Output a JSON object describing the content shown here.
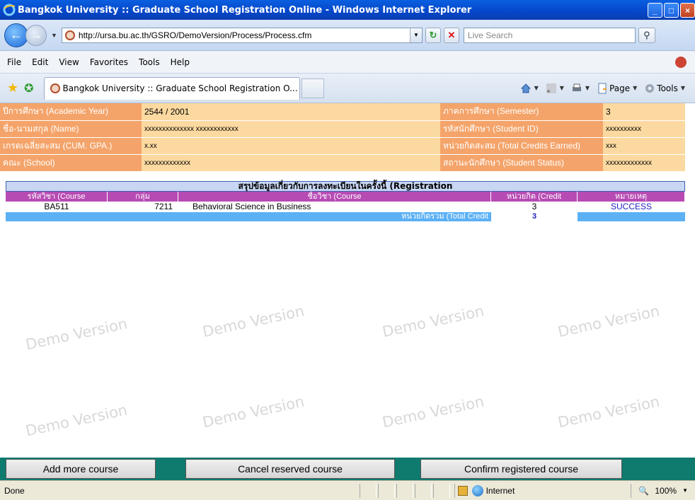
{
  "window": {
    "title": "Bangkok University :: Graduate School Registration Online - Windows Internet Explorer",
    "minimize": "_",
    "maximize": "□",
    "close": "×"
  },
  "address": {
    "url": "http://ursa.bu.ac.th/GSRO/DemoVersion/Process/Process.cfm",
    "search_placeholder": "Live Search"
  },
  "menu": [
    "File",
    "Edit",
    "View",
    "Favorites",
    "Tools",
    "Help"
  ],
  "tab": {
    "label": "Bangkok University :: Graduate School Registration O..."
  },
  "commands": {
    "page": "Page",
    "tools": "Tools"
  },
  "student_info": {
    "academic_year": {
      "label": "ปีการศึกษา (Academic Year)",
      "value": "2544 / 2001"
    },
    "semester": {
      "label": "ภาคการศึกษา (Semester)",
      "value": "3"
    },
    "name": {
      "label": "ชื่อ-นามสกุล (Name)",
      "value": "xxxxxxxxxxxxxx xxxxxxxxxxxx"
    },
    "student_id": {
      "label": "รหัสนักศึกษา (Student ID)",
      "value": "xxxxxxxxxx"
    },
    "gpa": {
      "label": "เกรดเฉลี่ยสะสม (CUM. GPA.)",
      "value": "x.xx"
    },
    "credits_earned": {
      "label": "หน่วยกิตสะสม (Total Credits Earned)",
      "value": "xxx"
    },
    "school": {
      "label": "คณะ (School)",
      "value": "xxxxxxxxxxxxx"
    },
    "status": {
      "label": "สถานะนักศึกษา (Student Status)",
      "value": "xxxxxxxxxxxxx"
    }
  },
  "registration": {
    "heading": "สรุปข้อมูลเกี่ยวกับการลงทะเบียนในครั้งนี้ (Registration",
    "columns": {
      "course": "รหัสวิชา (Course",
      "section": "กลุ่ม",
      "course_name": "ชื่อวิชา (Course",
      "credit": "หน่วยกิต (Credit",
      "remark": "หมายเหตุ"
    },
    "rows": [
      {
        "course": "BA511",
        "section": "7211",
        "name": "Behavioral Science in Business",
        "credit": "3",
        "remark": "SUCCESS"
      }
    ],
    "total_label": "หน่วยกิตรวม (Total Credit",
    "total_value": "3"
  },
  "watermark": "Demo Version",
  "buttons": {
    "add": "Add more course",
    "cancel": "Cancel reserved course",
    "confirm": "Confirm registered course"
  },
  "statusbar": {
    "text": "Done",
    "zone": "Internet",
    "zoom": "100%"
  },
  "colors": {
    "label_bg": "#f4a46a",
    "value_bg": "#fcd9a0",
    "column_header": "#b74bb4",
    "total_bar": "#5cb1f5",
    "button_bar": "#0f7a6e"
  }
}
